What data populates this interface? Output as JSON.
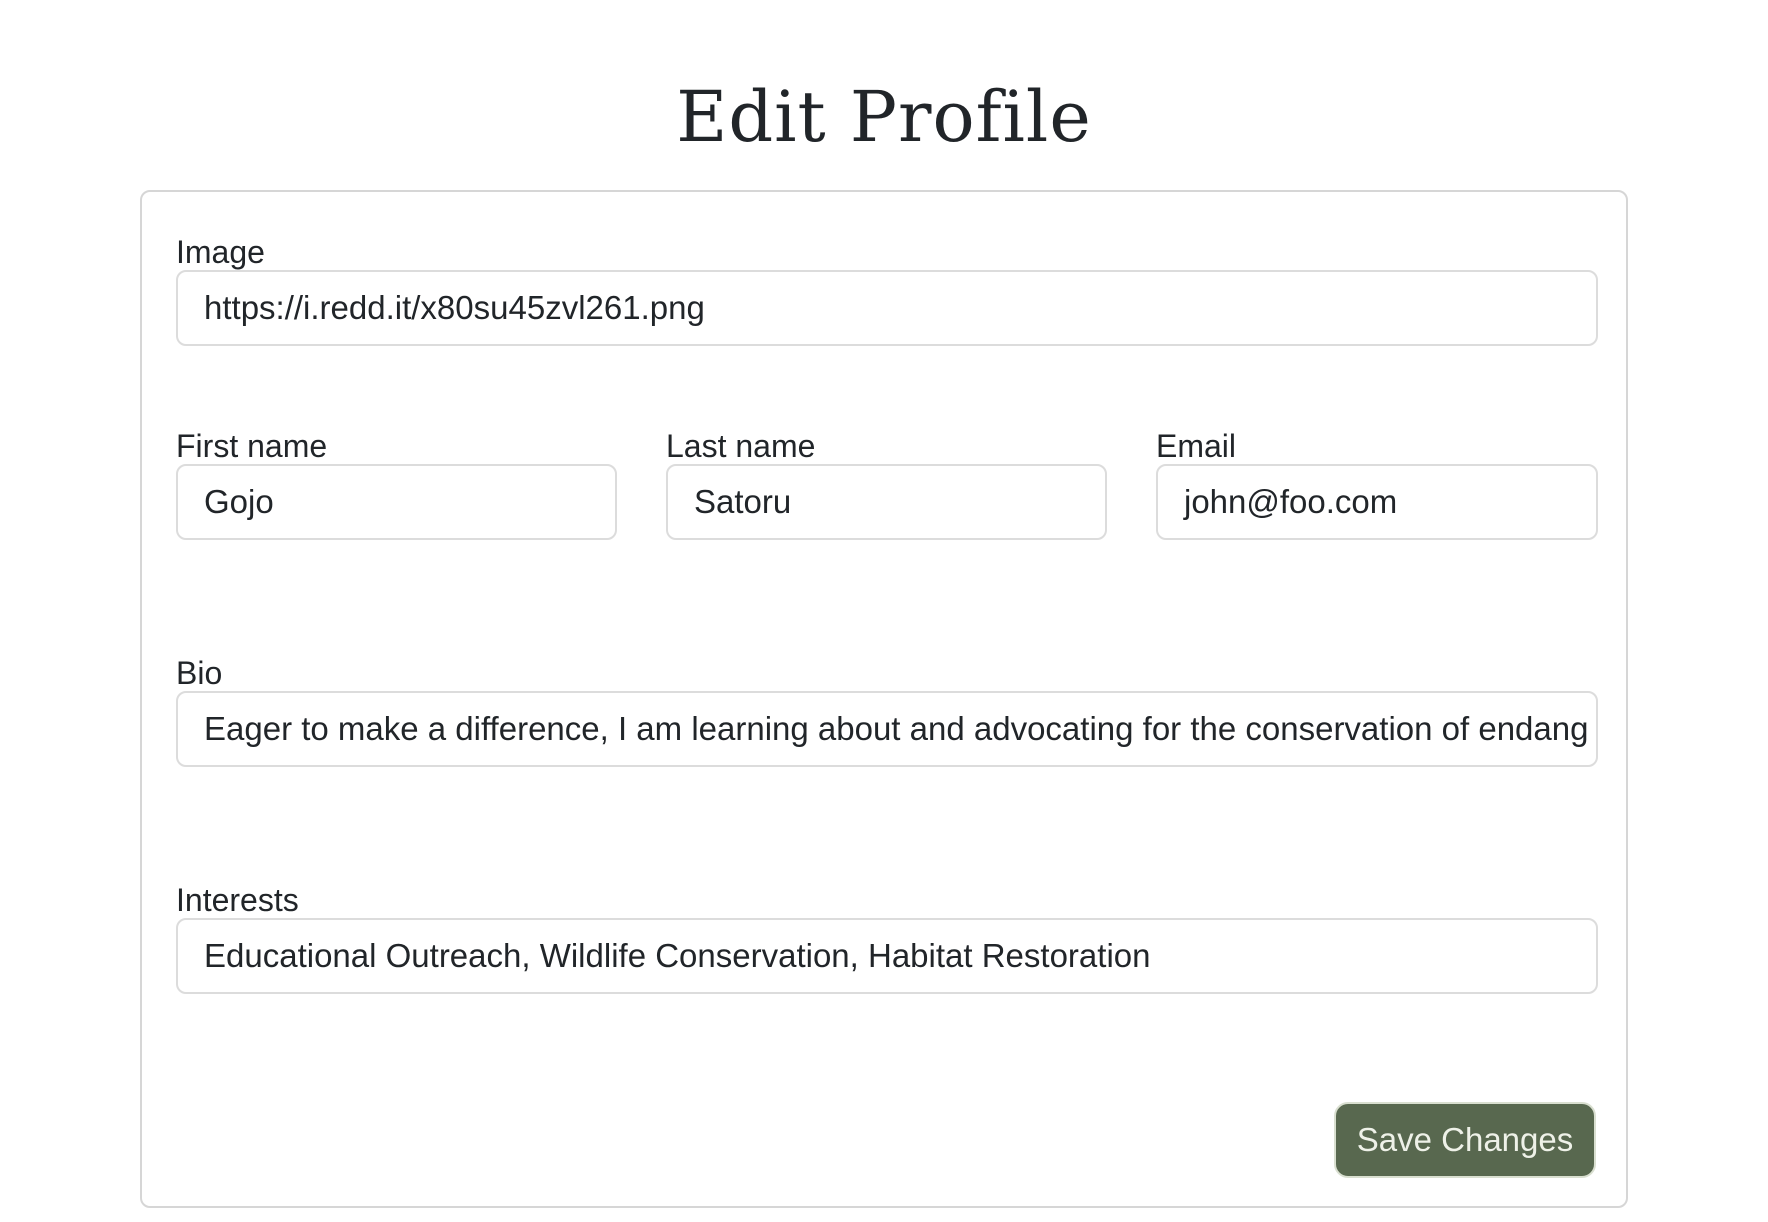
{
  "page": {
    "title": "Edit Profile"
  },
  "form": {
    "image": {
      "label": "Image",
      "value": "https://i.redd.it/x80su45zvl261.png"
    },
    "first_name": {
      "label": "First name",
      "value": "Gojo"
    },
    "last_name": {
      "label": "Last name",
      "value": "Satoru"
    },
    "email": {
      "label": "Email",
      "value": "john@foo.com"
    },
    "bio": {
      "label": "Bio",
      "value": "Eager to make a difference, I am learning about and advocating for the conservation of endang"
    },
    "interests": {
      "label": "Interests",
      "value": "Educational Outreach, Wildlife Conservation, Habitat Restoration"
    },
    "save_label": "Save Changes"
  },
  "colors": {
    "text": "#212529",
    "border": "#dcdcdc",
    "save_button_bg": "#58684f",
    "save_button_text": "#eef1e8"
  }
}
